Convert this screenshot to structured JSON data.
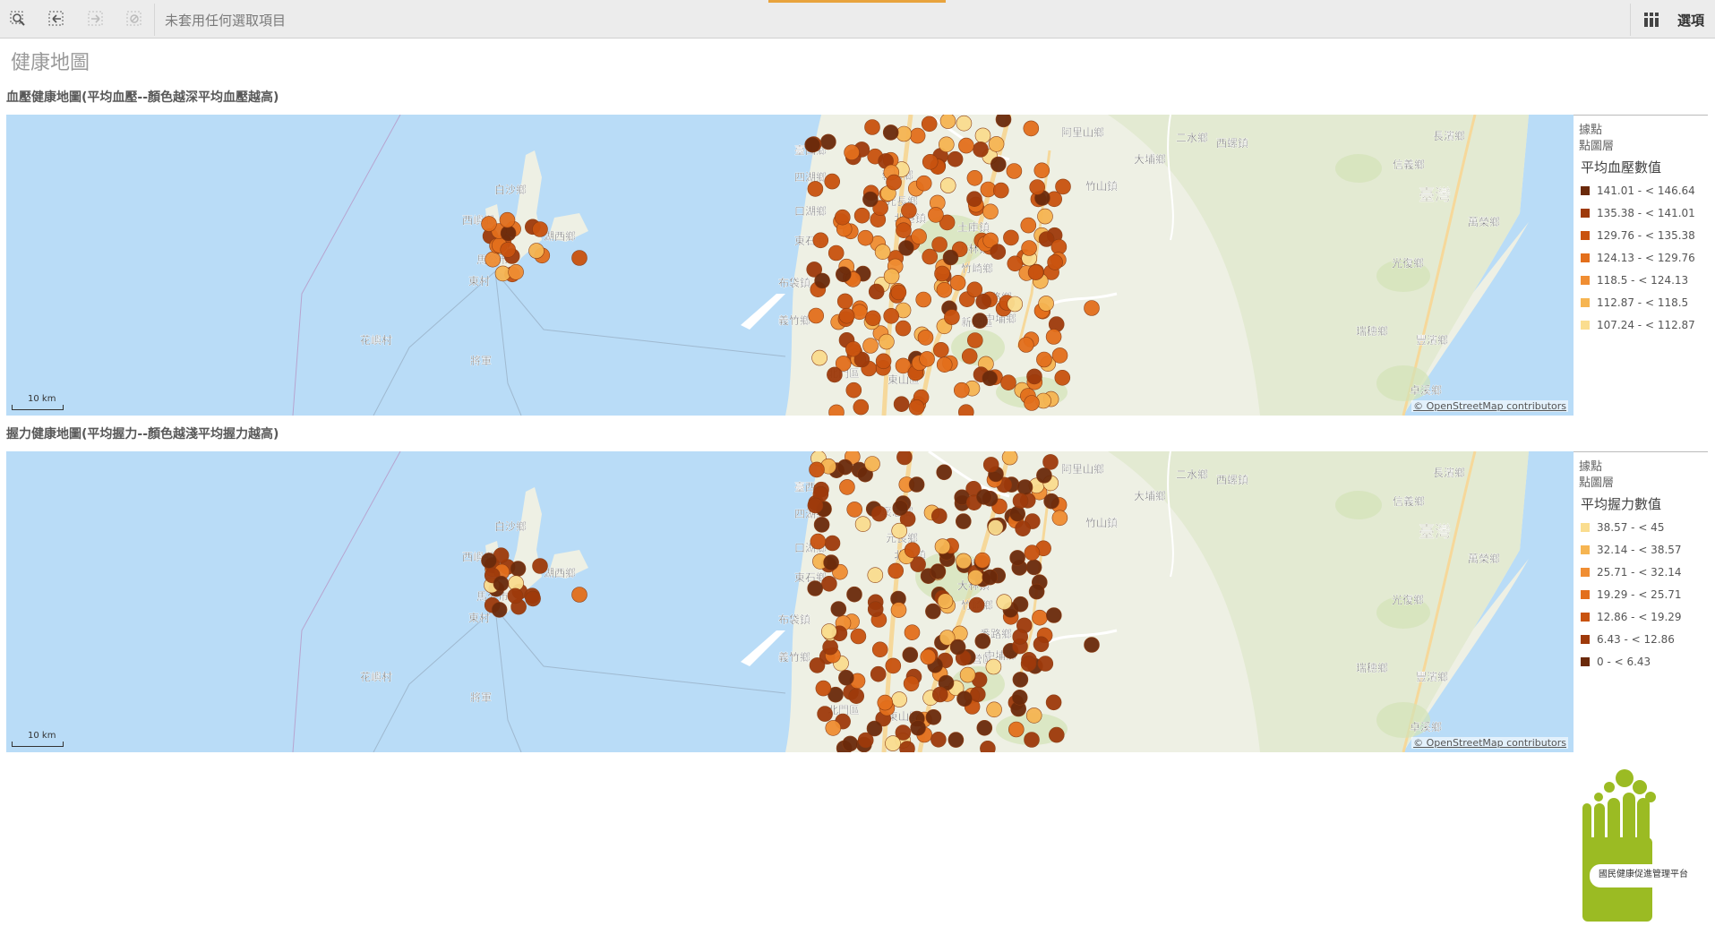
{
  "toolbar": {
    "selection_status": "未套用任何選取項目",
    "options_label": "選項",
    "icons": [
      "smart-search-icon",
      "step-back-icon",
      "step-forward-icon",
      "clear-selections-icon",
      "grid-icon"
    ]
  },
  "page": {
    "title": "健康地圖"
  },
  "colors": {
    "toolbar_accent": "#e8a33d",
    "water": "#b9dcf7",
    "land": "#eef0e4",
    "road": "#f6d89a"
  },
  "maps": [
    {
      "title": "血壓健康地圖(平均血壓--顏色越深平均血壓越高)",
      "layer_label": "據點",
      "layer_sub_label": "點圖層",
      "legend_title": "平均血壓數值",
      "legend": [
        {
          "range": "141.01 - < 146.64",
          "color": "#6b2a0b"
        },
        {
          "range": "135.38 - < 141.01",
          "color": "#9e3a0b"
        },
        {
          "range": "129.76 - < 135.38",
          "color": "#c9530f"
        },
        {
          "range": "124.13 - < 129.76",
          "color": "#e36f1c"
        },
        {
          "range": "118.5 - < 124.13",
          "color": "#f08e33"
        },
        {
          "range": "112.87 - < 118.5",
          "color": "#f6b552"
        },
        {
          "range": "107.24 - < 112.87",
          "color": "#fadd8f"
        }
      ],
      "scale_label": "10 km",
      "attribution": "© OpenStreetMap contributors"
    },
    {
      "title": "握力健康地圖(平均握力--顏色越淺平均握力越高)",
      "layer_label": "據點",
      "layer_sub_label": "點圖層",
      "legend_title": "平均握力數值",
      "legend": [
        {
          "range": "38.57 - < 45",
          "color": "#fadd8f"
        },
        {
          "range": "32.14 - < 38.57",
          "color": "#f6b552"
        },
        {
          "range": "25.71 - < 32.14",
          "color": "#f08e33"
        },
        {
          "range": "19.29 - < 25.71",
          "color": "#e36f1c"
        },
        {
          "range": "12.86 - < 19.29",
          "color": "#c9530f"
        },
        {
          "range": "6.43 - < 12.86",
          "color": "#9e3a0b"
        },
        {
          "range": "0 - < 6.43",
          "color": "#6b2a0b"
        }
      ],
      "scale_label": "10 km",
      "attribution": "© OpenStreetMap contributors"
    }
  ],
  "place_labels": [
    "西嶼鄉",
    "白沙鄉",
    "湖西鄉",
    "馬公市",
    "東村",
    "花嶼村",
    "將軍",
    "麥寮鄉",
    "臺西鄉",
    "四湖鄉",
    "口湖鄉",
    "東石鄉",
    "布袋鎮",
    "義竹鄉",
    "新營區",
    "東山區",
    "褒忠鄉",
    "元長鄉",
    "北港鎮",
    "土庫鎮",
    "大林鎮",
    "竹崎鄉",
    "番路鄉",
    "中埔鄉",
    "大埔鄉",
    "阿里山鄉",
    "竹山鎮",
    "信義鄉",
    "二水鄉",
    "西螺鎮",
    "臺灣",
    "萬榮鄉",
    "光復鄉",
    "豐濱鄉",
    "瑞穗鄉",
    "卓溪鄉",
    "長濱鄉",
    "北門區"
  ],
  "logo": {
    "caption": "國民健康促進管理平台"
  }
}
